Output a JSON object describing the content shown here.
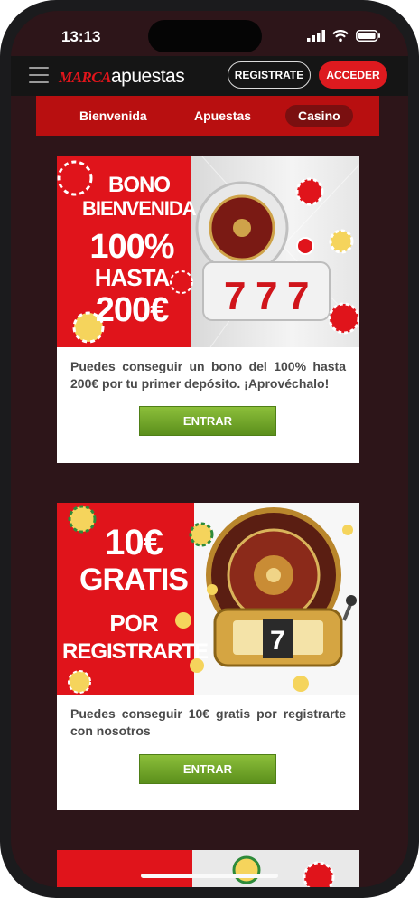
{
  "status_bar": {
    "time": "13:13"
  },
  "header": {
    "logo_marca": "MARCA",
    "logo_apuestas": "apuestas",
    "register_label": "REGISTRATE",
    "login_label": "ACCEDER"
  },
  "tabs": [
    {
      "label": "Bienvenida",
      "active": false
    },
    {
      "label": "Apuestas",
      "active": false
    },
    {
      "label": "Casino",
      "active": true
    }
  ],
  "offers": [
    {
      "banner_lines": [
        "BONO",
        "BIENVENIDA",
        "100%",
        "HASTA",
        "200€"
      ],
      "description": "Puedes conseguir un bono del 100% hasta 200€ por tu primer depósito. ¡Aprovéchalo!",
      "button_label": "ENTRAR"
    },
    {
      "banner_lines": [
        "10€",
        "GRATIS",
        "POR",
        "REGISTRARTE"
      ],
      "description": "Puedes conseguir 10€ gratis por registrarte con nosotros",
      "button_label": "ENTRAR"
    }
  ],
  "colors": {
    "brand_red": "#e0141b",
    "tab_bar": "#b80f10",
    "background": "#2d1519",
    "button_green": "#6fa52a"
  }
}
